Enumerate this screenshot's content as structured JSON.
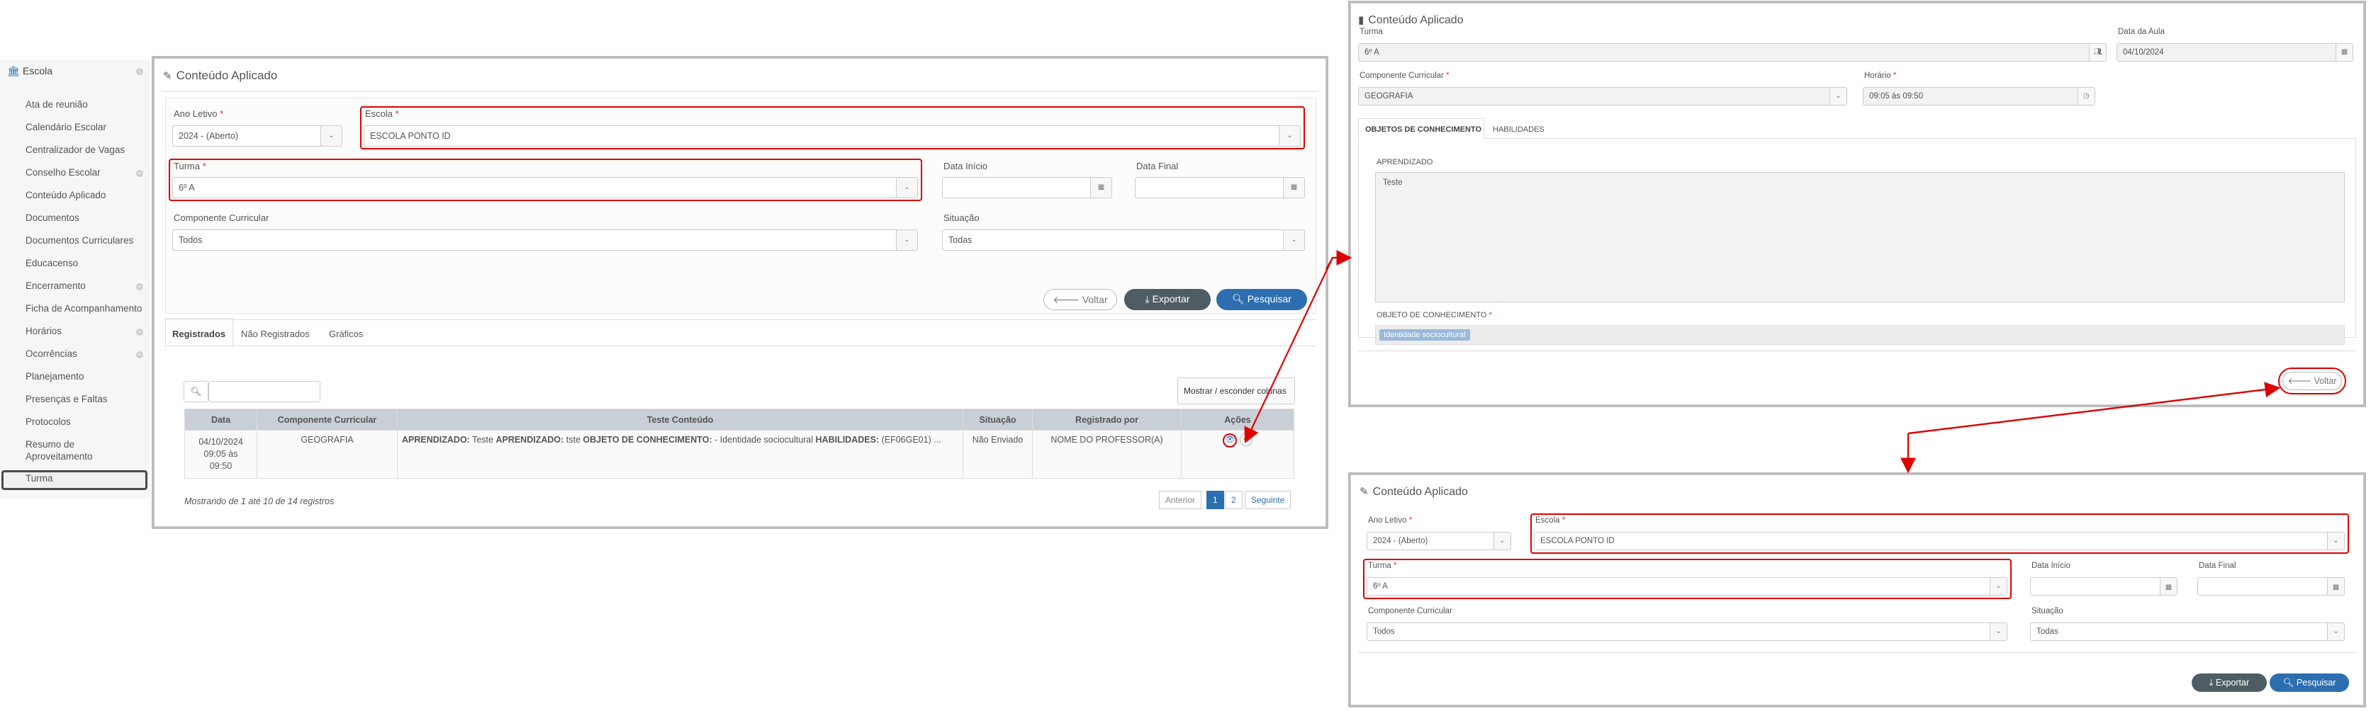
{
  "sidebar": {
    "header": "Escola",
    "items": [
      {
        "label": "Ata de reunião"
      },
      {
        "label": "Calendário Escolar"
      },
      {
        "label": "Centralizador de Vagas"
      },
      {
        "label": "Conselho Escolar"
      },
      {
        "label": "Conteúdo Aplicado"
      },
      {
        "label": "Documentos"
      },
      {
        "label": "Documentos Curriculares"
      },
      {
        "label": "Educacenso"
      },
      {
        "label": "Encerramento"
      },
      {
        "label": "Ficha de Acompanhamento"
      },
      {
        "label": "Horários"
      },
      {
        "label": "Ocorrências"
      },
      {
        "label": "Planejamento"
      },
      {
        "label": "Presenças e Faltas"
      },
      {
        "label": "Protocolos"
      },
      {
        "label": "Resumo de"
      },
      {
        "label": "Aproveitamento"
      },
      {
        "label": "Turma"
      }
    ]
  },
  "main": {
    "title": "Conteúdo Aplicado",
    "ano_letivo": {
      "label": "Ano Letivo",
      "value": "2024 - (Aberto)"
    },
    "escola": {
      "label": "Escola",
      "value": "ESCOLA PONTO ID"
    },
    "turma": {
      "label": "Turma",
      "value": "6º A"
    },
    "data_inicio": {
      "label": "Data Início"
    },
    "data_final": {
      "label": "Data Final"
    },
    "componente": {
      "label": "Componente Curricular",
      "value": "Todos"
    },
    "situacao": {
      "label": "Situação",
      "value": "Todas"
    },
    "buttons": {
      "voltar": "Voltar",
      "exportar": "Exportar",
      "pesquisar": "Pesquisar"
    },
    "tabs": [
      "Registrados",
      "Não Registrados",
      "Gráficos"
    ],
    "toggle_columns": "Mostrar / esconder colunas",
    "table": {
      "headers": [
        "Data",
        "Componente Curricular",
        "Teste Conteúdo",
        "Situação",
        "Registrado por",
        "Ações"
      ],
      "row": {
        "data_line1": "04/10/2024",
        "data_line2": "09:05 às",
        "data_line3": "09:50",
        "componente": "GEOGRAFIA",
        "k1": "APRENDIZADO:",
        "v1": " Teste ",
        "k2": "APRENDIZADO:",
        "v2": " tste ",
        "k3": "OBJETO DE CONHECIMENTO:",
        "v3": " - Identidade sociocultural ",
        "k4": "HABILIDADES:",
        "v4": " (EF06GE01) ...",
        "situacao": "Não Enviado",
        "registrado_por": "NOME DO PROFESSOR(A)"
      }
    },
    "footer": "Mostrando de 1 até 10 de 14 registros",
    "pagination": [
      "Anterior",
      "1",
      "2",
      "Seguinte"
    ]
  },
  "detail": {
    "title": "Conteúdo Aplicado",
    "turma": {
      "label": "Turma",
      "value": "6º A"
    },
    "data_aula": {
      "label": "Data da Aula",
      "value": "04/10/2024"
    },
    "componente": {
      "label": "Componente Curricular",
      "value": "GEOGRAFIA"
    },
    "horario": {
      "label": "Horário",
      "value": "09:05 às 09:50"
    },
    "tabs": [
      "OBJETOS DE CONHECIMENTO",
      "HABILIDADES"
    ],
    "aprendizado_label": "APRENDIZADO",
    "aprendizado_value": "Teste",
    "objeto_label": "OBJETO DE CONHECIMENTO",
    "objeto_tag": "Identidade sociocultural",
    "voltar": "Voltar"
  },
  "result": {
    "title": "Conteúdo Aplicado",
    "ano_letivo": {
      "label": "Ano Letivo",
      "value": "2024 - (Aberto)"
    },
    "escola": {
      "label": "Escola",
      "value": "ESCOLA PONTO ID"
    },
    "turma": {
      "label": "Turma",
      "value": "6º A"
    },
    "data_inicio": {
      "label": "Data Início"
    },
    "data_final": {
      "label": "Data Final"
    },
    "componente": {
      "label": "Componente Curricular",
      "value": "Todos"
    },
    "situacao": {
      "label": "Situação",
      "value": "Todas"
    },
    "exportar": "Exportar",
    "pesquisar": "Pesquisar"
  },
  "colors": {
    "highlight": "#dd0000",
    "primary": "#2c6eb0",
    "dark_button": "#4e5d63",
    "table_header": "#c9cfd6"
  }
}
